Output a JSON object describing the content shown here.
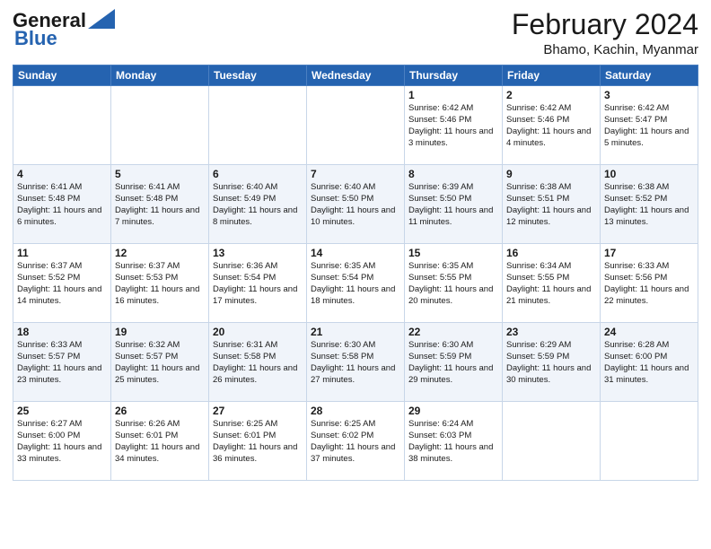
{
  "header": {
    "logo_line1": "General",
    "logo_line2": "Blue",
    "title": "February 2024",
    "location": "Bhamo, Kachin, Myanmar"
  },
  "days_of_week": [
    "Sunday",
    "Monday",
    "Tuesday",
    "Wednesday",
    "Thursday",
    "Friday",
    "Saturday"
  ],
  "weeks": [
    [
      {
        "day": "",
        "info": ""
      },
      {
        "day": "",
        "info": ""
      },
      {
        "day": "",
        "info": ""
      },
      {
        "day": "",
        "info": ""
      },
      {
        "day": "1",
        "info": "Sunrise: 6:42 AM\nSunset: 5:46 PM\nDaylight: 11 hours and 3 minutes."
      },
      {
        "day": "2",
        "info": "Sunrise: 6:42 AM\nSunset: 5:46 PM\nDaylight: 11 hours and 4 minutes."
      },
      {
        "day": "3",
        "info": "Sunrise: 6:42 AM\nSunset: 5:47 PM\nDaylight: 11 hours and 5 minutes."
      }
    ],
    [
      {
        "day": "4",
        "info": "Sunrise: 6:41 AM\nSunset: 5:48 PM\nDaylight: 11 hours and 6 minutes."
      },
      {
        "day": "5",
        "info": "Sunrise: 6:41 AM\nSunset: 5:48 PM\nDaylight: 11 hours and 7 minutes."
      },
      {
        "day": "6",
        "info": "Sunrise: 6:40 AM\nSunset: 5:49 PM\nDaylight: 11 hours and 8 minutes."
      },
      {
        "day": "7",
        "info": "Sunrise: 6:40 AM\nSunset: 5:50 PM\nDaylight: 11 hours and 10 minutes."
      },
      {
        "day": "8",
        "info": "Sunrise: 6:39 AM\nSunset: 5:50 PM\nDaylight: 11 hours and 11 minutes."
      },
      {
        "day": "9",
        "info": "Sunrise: 6:38 AM\nSunset: 5:51 PM\nDaylight: 11 hours and 12 minutes."
      },
      {
        "day": "10",
        "info": "Sunrise: 6:38 AM\nSunset: 5:52 PM\nDaylight: 11 hours and 13 minutes."
      }
    ],
    [
      {
        "day": "11",
        "info": "Sunrise: 6:37 AM\nSunset: 5:52 PM\nDaylight: 11 hours and 14 minutes."
      },
      {
        "day": "12",
        "info": "Sunrise: 6:37 AM\nSunset: 5:53 PM\nDaylight: 11 hours and 16 minutes."
      },
      {
        "day": "13",
        "info": "Sunrise: 6:36 AM\nSunset: 5:54 PM\nDaylight: 11 hours and 17 minutes."
      },
      {
        "day": "14",
        "info": "Sunrise: 6:35 AM\nSunset: 5:54 PM\nDaylight: 11 hours and 18 minutes."
      },
      {
        "day": "15",
        "info": "Sunrise: 6:35 AM\nSunset: 5:55 PM\nDaylight: 11 hours and 20 minutes."
      },
      {
        "day": "16",
        "info": "Sunrise: 6:34 AM\nSunset: 5:55 PM\nDaylight: 11 hours and 21 minutes."
      },
      {
        "day": "17",
        "info": "Sunrise: 6:33 AM\nSunset: 5:56 PM\nDaylight: 11 hours and 22 minutes."
      }
    ],
    [
      {
        "day": "18",
        "info": "Sunrise: 6:33 AM\nSunset: 5:57 PM\nDaylight: 11 hours and 23 minutes."
      },
      {
        "day": "19",
        "info": "Sunrise: 6:32 AM\nSunset: 5:57 PM\nDaylight: 11 hours and 25 minutes."
      },
      {
        "day": "20",
        "info": "Sunrise: 6:31 AM\nSunset: 5:58 PM\nDaylight: 11 hours and 26 minutes."
      },
      {
        "day": "21",
        "info": "Sunrise: 6:30 AM\nSunset: 5:58 PM\nDaylight: 11 hours and 27 minutes."
      },
      {
        "day": "22",
        "info": "Sunrise: 6:30 AM\nSunset: 5:59 PM\nDaylight: 11 hours and 29 minutes."
      },
      {
        "day": "23",
        "info": "Sunrise: 6:29 AM\nSunset: 5:59 PM\nDaylight: 11 hours and 30 minutes."
      },
      {
        "day": "24",
        "info": "Sunrise: 6:28 AM\nSunset: 6:00 PM\nDaylight: 11 hours and 31 minutes."
      }
    ],
    [
      {
        "day": "25",
        "info": "Sunrise: 6:27 AM\nSunset: 6:00 PM\nDaylight: 11 hours and 33 minutes."
      },
      {
        "day": "26",
        "info": "Sunrise: 6:26 AM\nSunset: 6:01 PM\nDaylight: 11 hours and 34 minutes."
      },
      {
        "day": "27",
        "info": "Sunrise: 6:25 AM\nSunset: 6:01 PM\nDaylight: 11 hours and 36 minutes."
      },
      {
        "day": "28",
        "info": "Sunrise: 6:25 AM\nSunset: 6:02 PM\nDaylight: 11 hours and 37 minutes."
      },
      {
        "day": "29",
        "info": "Sunrise: 6:24 AM\nSunset: 6:03 PM\nDaylight: 11 hours and 38 minutes."
      },
      {
        "day": "",
        "info": ""
      },
      {
        "day": "",
        "info": ""
      }
    ]
  ]
}
